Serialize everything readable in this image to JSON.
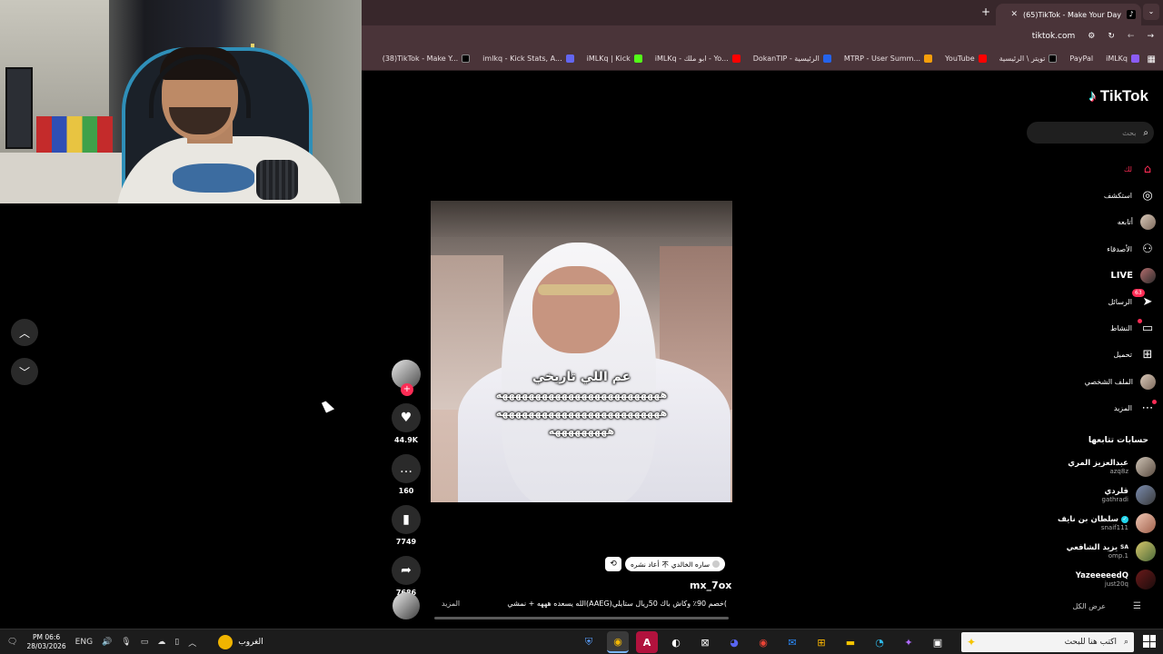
{
  "browser": {
    "tab_title": "(65)TikTok - Make Your Day",
    "new_tab_icon": "plus-icon",
    "url": "tiktok.com",
    "bookmarks": [
      {
        "label": "iMLKq",
        "color": "#8b5cf6"
      },
      {
        "label": "PayPal",
        "color": "#1d4ed8"
      },
      {
        "label": "تويتر \\ الرئيسية",
        "color": "#000000"
      },
      {
        "label": "YouTube",
        "color": "#ff0000"
      },
      {
        "label": "MTRP - User Summ...",
        "color": "#f59e0b"
      },
      {
        "label": "DokanTIP - الرئيسية",
        "color": "#2563eb"
      },
      {
        "label": "iMLKq - ابو ملك - Yo...",
        "color": "#ff0000"
      },
      {
        "label": "iMLKq | Kick",
        "color": "#53fc18"
      },
      {
        "label": "imlkq - Kick Stats, A...",
        "color": "#6366f1"
      },
      {
        "label": "(38)TikTok - Make Y...",
        "color": "#000000"
      }
    ]
  },
  "tiktok": {
    "logo": "TikTok",
    "search_placeholder": "بحث",
    "nav": [
      {
        "label": "لك",
        "icon": "home-icon"
      },
      {
        "label": "استكشف",
        "icon": "compass-icon"
      },
      {
        "label": "أتابعه",
        "icon": "avatar-icon"
      },
      {
        "label": "الأصدقاء",
        "icon": "friends-icon"
      },
      {
        "label": "LIVE",
        "icon": "live-avatar-icon"
      },
      {
        "label": "الرسائل",
        "icon": "messages-icon",
        "badge": "63"
      },
      {
        "label": "النشاط",
        "icon": "activity-icon"
      },
      {
        "label": "تحميل",
        "icon": "upload-icon"
      },
      {
        "label": "الملف الشخصي",
        "icon": "profile-icon"
      },
      {
        "label": "المزيد",
        "icon": "more-icon"
      }
    ],
    "following_title": "حسابات تتابعها",
    "following": [
      {
        "name": "عبدالعزيز المري",
        "handle": "azq8z"
      },
      {
        "name": "قلردي",
        "handle": "gathradi"
      },
      {
        "name": "سلطان بن نايف",
        "handle": "snaif111",
        "verified": true
      },
      {
        "name": "يزيد الشافعي",
        "prefix": "SA",
        "handle": "omp.1"
      },
      {
        "name": "YazeeeeedQ",
        "handle": "just20q"
      }
    ],
    "see_all": "عرض الكل",
    "video": {
      "overlay_line1": "عم اللي تاريخي",
      "overlay_line2": "هههههههههههههههههههههههههه",
      "overlay_line3": "هههههههههههههههههههههههههه",
      "overlay_line4": "هههههههههه"
    },
    "actions": {
      "likes": "44.9K",
      "comments": "160",
      "saves": "7749",
      "shares": "7686"
    },
    "repost_label": "أعاد نشره",
    "repost_user": "ساره الخالدي",
    "repost_emoji": "不",
    "author": "mx_7ox",
    "caption": "الله يسعده هههه + نمشي(AAEG)خصم 90٪ وكاش باك 50ريال  ستايلي(",
    "caption_more": "المزيد",
    "progress": 0.0
  },
  "taskbar": {
    "time": "PM 06:6",
    "date": "28/03/2026",
    "lang": "ENG",
    "weather": "الغروب",
    "search_placeholder": "اكتب هنا للبحث",
    "notification_count": "8"
  }
}
